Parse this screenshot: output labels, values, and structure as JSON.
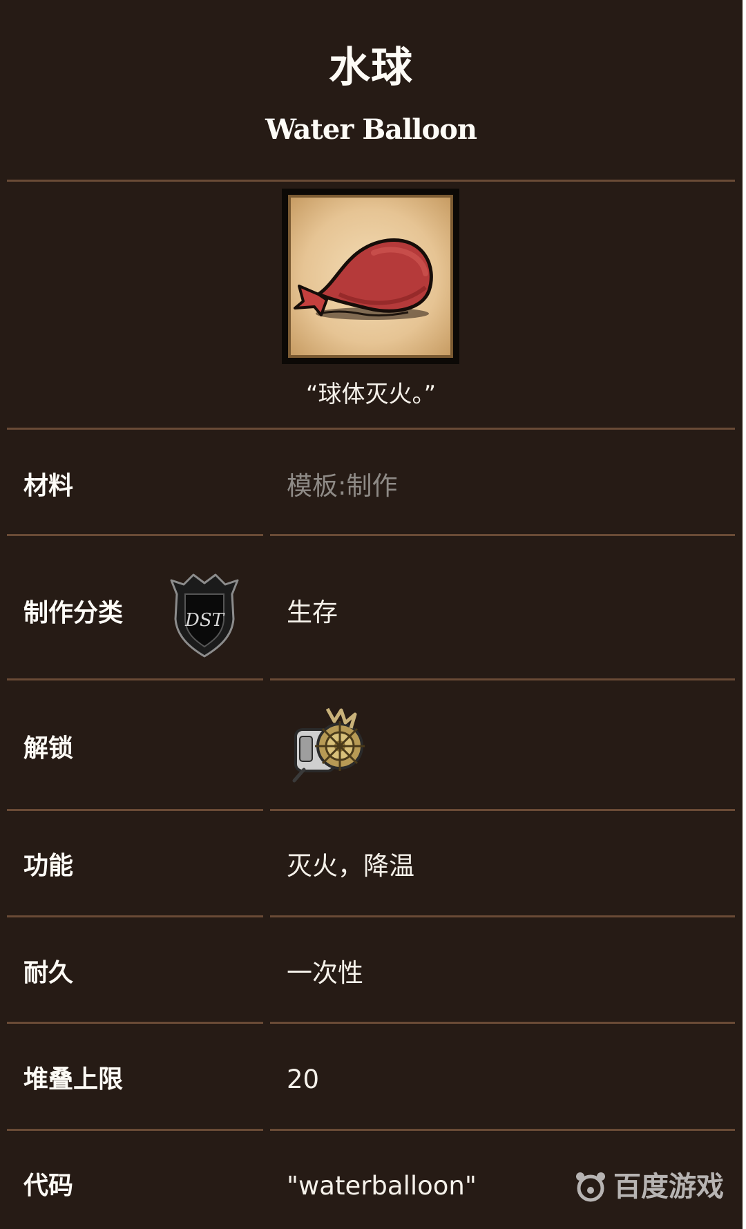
{
  "item": {
    "name_zh": "水球",
    "name_en": "Water Balloon",
    "image_icon": "water-balloon-icon",
    "quote": "“球体灭火。”"
  },
  "rows": [
    {
      "label": "材料",
      "value": "模板:制作",
      "value_style": "muted"
    },
    {
      "label": "制作分类",
      "value": "生存",
      "badge_icon": "dst-badge-icon"
    },
    {
      "label": "解锁",
      "value_icon": "science-machine-icon"
    },
    {
      "label": "功能",
      "value": "灭火，降温"
    },
    {
      "label": "耐久",
      "value": "一次性"
    },
    {
      "label": "堆叠上限",
      "value": "20"
    },
    {
      "label": "代码",
      "value": "\"waterballoon\""
    }
  ],
  "watermark": {
    "icon": "baidu-paw-icon",
    "text": "百度游戏"
  },
  "colors": {
    "background": "#261b15",
    "divider": "#6a4b36",
    "text": "#fdfbf6",
    "muted_text": "#8e8a86",
    "balloon_red": "#b53a3a"
  }
}
